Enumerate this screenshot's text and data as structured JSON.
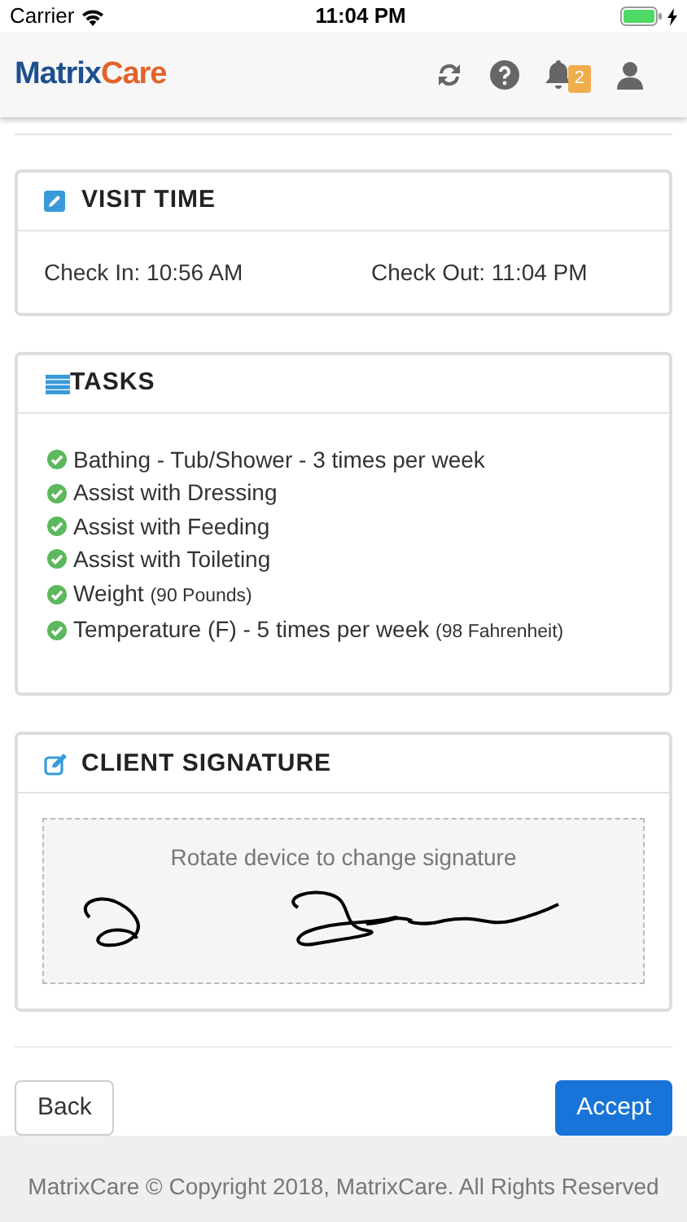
{
  "status_bar": {
    "carrier": "Carrier",
    "time": "11:04 PM"
  },
  "header": {
    "logo_left": "Matrix",
    "logo_right": "Care",
    "notification_count": "2"
  },
  "visit_time": {
    "title": "VISIT TIME",
    "check_in": "Check In: 10:56 AM",
    "check_out": "Check Out: 11:04 PM"
  },
  "tasks": {
    "title": "TASKS",
    "items": [
      {
        "label": "Bathing - Tub/Shower - 3 times per week",
        "done": true
      },
      {
        "label": "Assist with Dressing",
        "done": true
      },
      {
        "label": "Assist with Feeding",
        "done": true
      },
      {
        "label": "Assist with Toileting",
        "done": true
      },
      {
        "label": "Weight",
        "note": "(90 Pounds)",
        "done": true
      },
      {
        "label": "Temperature (F) - 5 times per week",
        "note": "(98 Fahrenheit)",
        "done": true
      }
    ]
  },
  "signature": {
    "title": "CLIENT SIGNATURE",
    "hint": "Rotate device to change signature"
  },
  "buttons": {
    "back": "Back",
    "accept": "Accept"
  },
  "footer": "MatrixCare © Copyright 2018, MatrixCare. All Rights Reserved"
}
